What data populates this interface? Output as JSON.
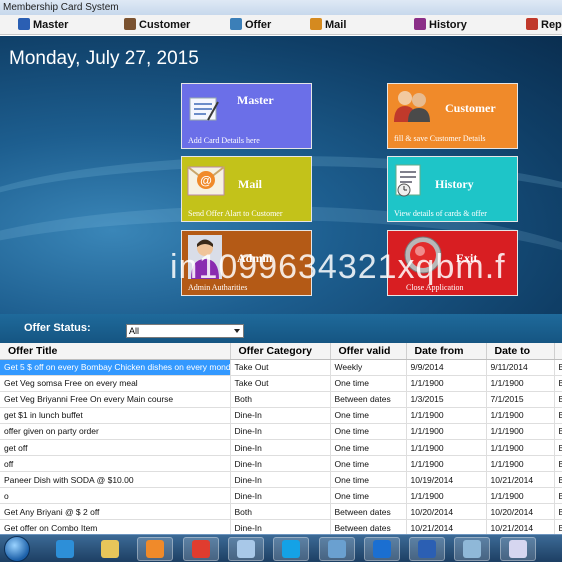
{
  "window": {
    "title": "Membership Card System"
  },
  "menu": [
    {
      "label": "Master",
      "color": "#2b5fb3"
    },
    {
      "label": "Customer",
      "color": "#7a5230"
    },
    {
      "label": "Offer",
      "color": "#3b7fb8"
    },
    {
      "label": "Mail",
      "color": "#d58a1f"
    },
    {
      "label": "History",
      "color": "#8b2f88"
    },
    {
      "label": "Rep",
      "color": "#c0392b"
    }
  ],
  "date": "Monday, July 27, 2015",
  "tiles": {
    "master": {
      "title": "Master",
      "subtitle": "Add Card Details here",
      "color": "#6b6fe8"
    },
    "customer": {
      "title": "Customer",
      "subtitle": "fill & save Customer Details",
      "color": "#f08a2a"
    },
    "mail": {
      "title": "Mail",
      "subtitle": "Send Offer Alart to Customer",
      "color": "#c3c21a"
    },
    "history": {
      "title": "History",
      "subtitle": "View details of cards & offer",
      "color": "#1ec5c8"
    },
    "admin": {
      "title": "Admin",
      "subtitle": "Admin Autharities",
      "color": "#b45a16"
    },
    "exit": {
      "title": "Exit",
      "subtitle": "Close Application",
      "color": "#d81e22"
    }
  },
  "watermark": "in1099634321xqbm.f",
  "offer_status": {
    "label": "Offer Status:",
    "selected": "All"
  },
  "table": {
    "columns": [
      "Offer Title",
      "Offer Category",
      "Offer valid",
      "Date from",
      "Date to",
      "C"
    ],
    "rows": [
      [
        "Get 5 $ off on  every Bombay Chicken dishes on every monda...",
        "Take Out",
        "Weekly",
        "9/9/2014",
        "9/11/2014",
        "B"
      ],
      [
        "Get Veg somsa Free on every meal",
        "Take Out",
        "One time",
        "1/1/1900",
        "1/1/1900",
        "B"
      ],
      [
        "Get Veg Briyanni Free On every Main course",
        "Both",
        "Between dates",
        "1/3/2015",
        "7/1/2015",
        "B"
      ],
      [
        "get  $1 in lunch buffet",
        "Dine-In",
        "One time",
        "1/1/1900",
        "1/1/1900",
        "B"
      ],
      [
        "offer given on party order",
        "Dine-In",
        "One time",
        "1/1/1900",
        "1/1/1900",
        "By"
      ],
      [
        "get off",
        "Dine-In",
        "One time",
        "1/1/1900",
        "1/1/1900",
        "B"
      ],
      [
        "off",
        "Dine-In",
        "One time",
        "1/1/1900",
        "1/1/1900",
        "B"
      ],
      [
        "Paneer Dish with SODA @ $10.00",
        "Dine-In",
        "One time",
        "10/19/2014",
        "10/21/2014",
        "B"
      ],
      [
        "o",
        "Dine-In",
        "One time",
        "1/1/1900",
        "1/1/1900",
        "B"
      ],
      [
        "Get  Any Briyani @ $ 2 off",
        "Both",
        "Between dates",
        "10/20/2014",
        "10/20/2014",
        "B"
      ],
      [
        "Get offer on Combo Item",
        "Dine-In",
        "Between dates",
        "10/21/2014",
        "10/21/2014",
        "B"
      ]
    ]
  },
  "taskbar": {
    "items": [
      {
        "icon": "internet-explorer-icon",
        "color": "#2d8fd8"
      },
      {
        "icon": "file-explorer-icon",
        "color": "#e8c65a"
      },
      {
        "icon": "media-player-icon",
        "color": "#f08a2a"
      },
      {
        "icon": "chrome-icon",
        "color": "#e03c2f"
      },
      {
        "icon": "notepad-icon",
        "color": "#a8c8e8"
      },
      {
        "icon": "skype-icon",
        "color": "#14a2e6"
      },
      {
        "icon": "app-window-icon",
        "color": "#6aa0d0"
      },
      {
        "icon": "teamviewer-icon",
        "color": "#1b6fd1"
      },
      {
        "icon": "word-icon",
        "color": "#2b5fb3"
      },
      {
        "icon": "membership-app-icon",
        "color": "#8fb8d8"
      },
      {
        "icon": "paint-icon",
        "color": "#d6d6f0"
      }
    ]
  }
}
